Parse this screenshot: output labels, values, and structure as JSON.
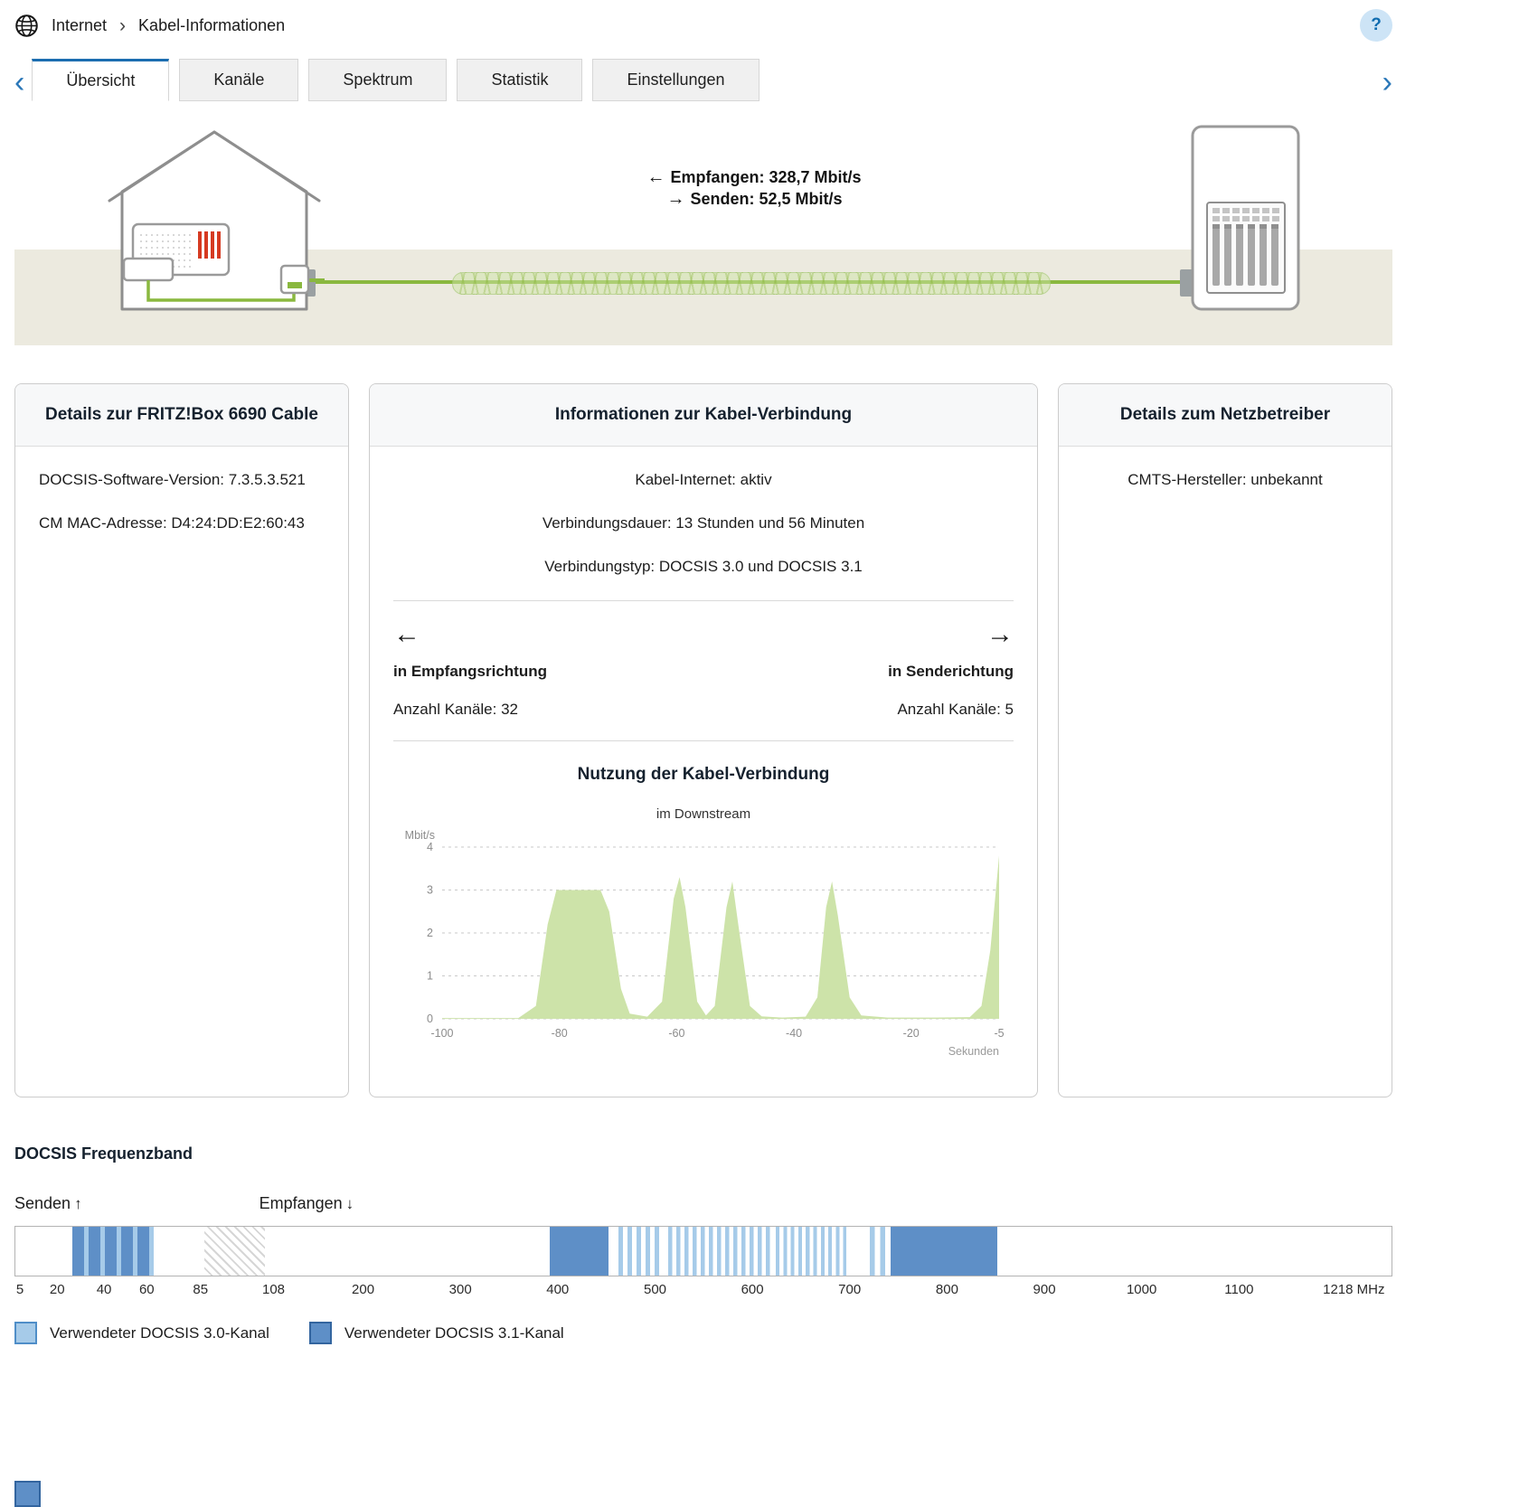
{
  "header": {
    "breadcrumb": {
      "section": "Internet",
      "separator": "›",
      "page": "Kabel-Informationen"
    },
    "help_label": "?"
  },
  "tabs": {
    "back_icon": "‹",
    "forward_icon": "›",
    "items": [
      {
        "name": "uebersicht",
        "label": "Übersicht",
        "active": true
      },
      {
        "name": "kanaele",
        "label": "Kanäle",
        "active": false
      },
      {
        "name": "spektrum",
        "label": "Spektrum",
        "active": false
      },
      {
        "name": "statistik",
        "label": "Statistik",
        "active": false
      },
      {
        "name": "einstellungen",
        "label": "Einstellungen",
        "active": false
      }
    ]
  },
  "diagram": {
    "receive_arrow": "←",
    "receive_label": "Empfangen: 328,7 Mbit/s",
    "send_arrow": "→",
    "send_label": "Senden: 52,5 Mbit/s"
  },
  "cards": {
    "box": {
      "title": "Details zur FRITZ!Box 6690 Cable",
      "lines": [
        "DOCSIS-Software-Version: 7.3.5.3.521",
        "CM MAC-Adresse: D4:24:DD:E2:60:43"
      ]
    },
    "connection": {
      "title": "Informationen zur Kabel-Verbindung",
      "status_lines": [
        "Kabel-Internet: aktiv",
        "Verbindungsdauer: 13 Stunden und 56 Minuten",
        "Verbindungstyp: DOCSIS 3.0 und DOCSIS 3.1"
      ],
      "receive_arrow": "←",
      "send_arrow": "→",
      "downstream": {
        "direction_label": "in Empfangsrichtung",
        "channels_label": "Anzahl Kanäle: 32"
      },
      "upstream": {
        "direction_label": "in Senderichtung",
        "channels_label": "Anzahl Kanäle: 5"
      }
    },
    "operator": {
      "title": "Details zum Netzbetreiber",
      "lines": [
        "CMTS-Hersteller: unbekannt"
      ]
    }
  },
  "chart_data": {
    "type": "area",
    "title": "Nutzung der Kabel-Verbindung",
    "subtitle": "im Downstream",
    "ylabel": "Mbit/s",
    "xlabel": "Sekunden",
    "xlim": [
      -100,
      -5
    ],
    "ylim": [
      0,
      4
    ],
    "yticks": [
      0,
      1,
      2,
      3,
      4
    ],
    "xticks": [
      -100,
      -80,
      -60,
      -40,
      -20,
      -5
    ],
    "grid": true,
    "fill": "#cde3a9",
    "points": [
      [
        -100,
        0.02
      ],
      [
        -87,
        0.02
      ],
      [
        -84,
        0.3
      ],
      [
        -82,
        2.2
      ],
      [
        -80.5,
        3.0
      ],
      [
        -73,
        3.0
      ],
      [
        -71.5,
        2.5
      ],
      [
        -69.5,
        0.7
      ],
      [
        -68,
        0.12
      ],
      [
        -65,
        0.05
      ],
      [
        -62.5,
        0.4
      ],
      [
        -60.5,
        2.8
      ],
      [
        -59.5,
        3.3
      ],
      [
        -58.5,
        2.6
      ],
      [
        -56.5,
        0.4
      ],
      [
        -55,
        0.08
      ],
      [
        -53.5,
        0.3
      ],
      [
        -51.5,
        2.6
      ],
      [
        -50.5,
        3.2
      ],
      [
        -49.5,
        2.2
      ],
      [
        -47.5,
        0.3
      ],
      [
        -45.5,
        0.06
      ],
      [
        -42,
        0.03
      ],
      [
        -38,
        0.05
      ],
      [
        -36,
        0.5
      ],
      [
        -34.5,
        2.6
      ],
      [
        -33.5,
        3.2
      ],
      [
        -32.5,
        2.4
      ],
      [
        -30.5,
        0.5
      ],
      [
        -28.5,
        0.08
      ],
      [
        -24,
        0.03
      ],
      [
        -16,
        0.03
      ],
      [
        -10,
        0.04
      ],
      [
        -8,
        0.3
      ],
      [
        -6.5,
        1.6
      ],
      [
        -5,
        3.8
      ]
    ]
  },
  "freq_band": {
    "title": "DOCSIS Frequenzband",
    "send_label": "Senden",
    "send_arrow": "↑",
    "receive_label": "Empfangen",
    "receive_arrow": "↓",
    "unit": "MHz",
    "ticks": [
      {
        "mhz": 5,
        "label": "5"
      },
      {
        "mhz": 20,
        "label": "20"
      },
      {
        "mhz": 40,
        "label": "40"
      },
      {
        "mhz": 60,
        "label": "60"
      },
      {
        "mhz": 85,
        "label": "85"
      },
      {
        "mhz": 108,
        "label": "108"
      },
      {
        "mhz": 200,
        "label": "200"
      },
      {
        "mhz": 300,
        "label": "300"
      },
      {
        "mhz": 400,
        "label": "400"
      },
      {
        "mhz": 500,
        "label": "500"
      },
      {
        "mhz": 600,
        "label": "600"
      },
      {
        "mhz": 700,
        "label": "700"
      },
      {
        "mhz": 800,
        "label": "800"
      },
      {
        "mhz": 900,
        "label": "900"
      },
      {
        "mhz": 1000,
        "label": "1000"
      },
      {
        "mhz": 1100,
        "label": "1100"
      },
      {
        "mhz": 1218,
        "label": "1218 MHz"
      }
    ],
    "blocks": [
      {
        "kind": "upstream31",
        "start_mhz": 26,
        "end_mhz": 63
      },
      {
        "kind": "hatch",
        "start_mhz": 86,
        "end_mhz": 105
      },
      {
        "kind": "docsis31",
        "start_mhz": 392,
        "end_mhz": 452
      },
      {
        "kind": "docsis30",
        "start_mhz": 462,
        "end_mhz": 504,
        "channels": 5
      },
      {
        "kind": "docsis30",
        "start_mhz": 513,
        "end_mhz": 618,
        "channels": 13
      },
      {
        "kind": "docsis30",
        "start_mhz": 624,
        "end_mhz": 697,
        "channels": 10
      },
      {
        "kind": "docsis30",
        "start_mhz": 721,
        "end_mhz": 737,
        "channels": 2
      },
      {
        "kind": "docsis31",
        "start_mhz": 742,
        "end_mhz": 852
      }
    ],
    "legend": [
      {
        "kind": "docsis30",
        "label": "Verwendeter DOCSIS 3.0-Kanal"
      },
      {
        "kind": "docsis31",
        "label": "Verwendeter DOCSIS 3.1-Kanal"
      }
    ],
    "colors": {
      "docsis30": "#a6cbe9",
      "docsis31": "#5e8fc7"
    }
  }
}
